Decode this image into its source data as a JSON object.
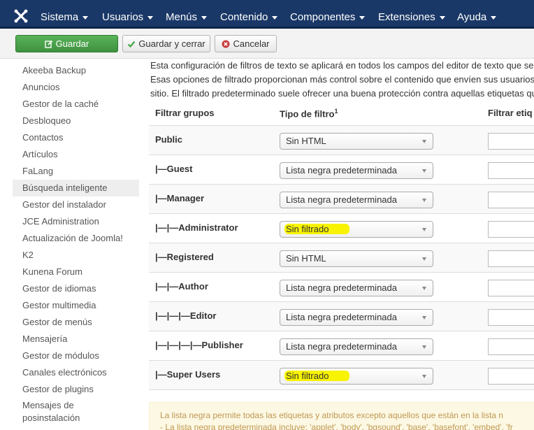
{
  "navbar": {
    "logo_icon": "joomla-logo-icon",
    "menus": [
      {
        "label": "Sistema"
      },
      {
        "label": "Usuarios"
      },
      {
        "label": "Menús"
      },
      {
        "label": "Contenido"
      },
      {
        "label": "Componentes"
      },
      {
        "label": "Extensiones"
      },
      {
        "label": "Ayuda"
      }
    ]
  },
  "toolbar": {
    "save_label": "Guardar",
    "save_close_label": "Guardar y cerrar",
    "cancel_label": "Cancelar"
  },
  "sidebar": {
    "items": [
      {
        "label": "Akeeba Backup"
      },
      {
        "label": "Anuncios"
      },
      {
        "label": "Gestor de la caché"
      },
      {
        "label": "Desbloqueo"
      },
      {
        "label": "Contactos"
      },
      {
        "label": "Artículos"
      },
      {
        "label": "FaLang"
      },
      {
        "label": "Búsqueda inteligente"
      },
      {
        "label": "Gestor del instalador"
      },
      {
        "label": "JCE Administration"
      },
      {
        "label": "Actualización de Joomla!"
      },
      {
        "label": "K2"
      },
      {
        "label": "Kunena Forum"
      },
      {
        "label": "Gestor de idiomas"
      },
      {
        "label": "Gestor multimedia"
      },
      {
        "label": "Gestor de menús"
      },
      {
        "label": "Mensajería"
      },
      {
        "label": "Gestor de módulos"
      },
      {
        "label": "Canales electrónicos"
      },
      {
        "label": "Gestor de plugins"
      },
      {
        "label": "Mensajes de posinstalación"
      }
    ]
  },
  "main": {
    "description_lines": [
      "Esta configuración de filtros de texto se aplicará en todos los campos del editor de texto que se",
      "Esas opciones de filtrado proporcionan más control sobre el contenido que envíen sus usuarios",
      "sitio. El filtrado predeterminado suele ofrecer una buena protección contra aquellas etiquetas que"
    ],
    "table": {
      "headers": {
        "group": "Filtrar grupos",
        "filter_type": "Tipo de filtro",
        "filter_type_sup": "1",
        "filter_tags": "Filtrar etiq"
      },
      "rows": [
        {
          "group": "Public",
          "filter": "Sin HTML",
          "highlighted": false
        },
        {
          "group": "|—Guest",
          "filter": "Lista negra predeterminada",
          "highlighted": false
        },
        {
          "group": "|—Manager",
          "filter": "Lista negra predeterminada",
          "highlighted": false
        },
        {
          "group": "|—|—Administrator",
          "filter": "Sin filtrado",
          "highlighted": true
        },
        {
          "group": "|—Registered",
          "filter": "Sin HTML",
          "highlighted": false
        },
        {
          "group": "|—|—Author",
          "filter": "Lista negra predeterminada",
          "highlighted": false
        },
        {
          "group": "|—|—|—Editor",
          "filter": "Lista negra predeterminada",
          "highlighted": false
        },
        {
          "group": "|—|—|—|—Publisher",
          "filter": "Lista negra predeterminada",
          "highlighted": false
        },
        {
          "group": "|—Super Users",
          "filter": "Sin filtrado",
          "highlighted": true
        }
      ]
    },
    "note_lines": [
      "La lista negra permite todas las etiquetas y atributos excepto aquellos que están en la lista n",
      "- La lista negra predeterminada incluye: 'applet', 'body', 'bgsound', 'base', 'basefont', 'embed', 'fr"
    ]
  },
  "colors": {
    "navbar_bg": "#1a3867",
    "save_button": "#46a546",
    "highlight": "#f8f300",
    "note_bg": "#fcf8e3"
  }
}
